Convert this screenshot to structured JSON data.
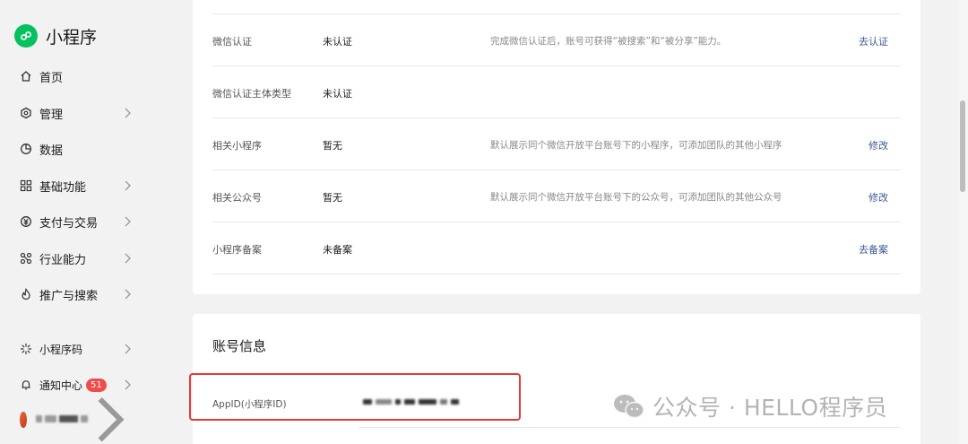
{
  "brand": {
    "title": "小程序",
    "logo_color": "#07c160"
  },
  "sidebar": {
    "items": [
      {
        "label": "首页",
        "icon": "home-icon",
        "has_chevron": false
      },
      {
        "label": "管理",
        "icon": "manage-icon",
        "has_chevron": true
      },
      {
        "label": "数据",
        "icon": "chart-icon",
        "has_chevron": false
      },
      {
        "label": "基础功能",
        "icon": "grid-icon",
        "has_chevron": true
      },
      {
        "label": "支付与交易",
        "icon": "payment-icon",
        "has_chevron": true
      },
      {
        "label": "行业能力",
        "icon": "industry-icon",
        "has_chevron": true
      },
      {
        "label": "推广与搜索",
        "icon": "fire-icon",
        "has_chevron": true
      }
    ],
    "bottom_items": [
      {
        "label": "小程序码",
        "icon": "qrcode-icon",
        "has_chevron": true
      },
      {
        "label": "通知中心",
        "icon": "bell-icon",
        "badge": "51",
        "has_chevron": true
      }
    ]
  },
  "info_rows": [
    {
      "label": "微信认证",
      "value": "未认证",
      "desc": "完成微信认证后，账号可获得“被搜索”和“被分享”能力。",
      "action": "去认证"
    },
    {
      "label": "微信认证主体类型",
      "value": "未认证",
      "desc": "",
      "action": ""
    },
    {
      "label": "相关小程序",
      "value": "暂无",
      "desc": "默认展示同个微信开放平台账号下的小程序，可添加团队的其他小程序",
      "action": "修改"
    },
    {
      "label": "相关公众号",
      "value": "暂无",
      "desc": "默认展示同个微信开放平台账号下的公众号，可添加团队的其他公众号",
      "action": "修改"
    },
    {
      "label": "小程序备案",
      "value": "未备案",
      "desc": "",
      "action": "去备案"
    }
  ],
  "account": {
    "section_title": "账号信息",
    "appid_label": "AppID(小程序ID)"
  },
  "watermark": {
    "text": "公众号 · HELLO程序员"
  },
  "colors": {
    "accent": "#3a5a94",
    "badge": "#f04c4c",
    "highlight": "#e33a3a"
  }
}
